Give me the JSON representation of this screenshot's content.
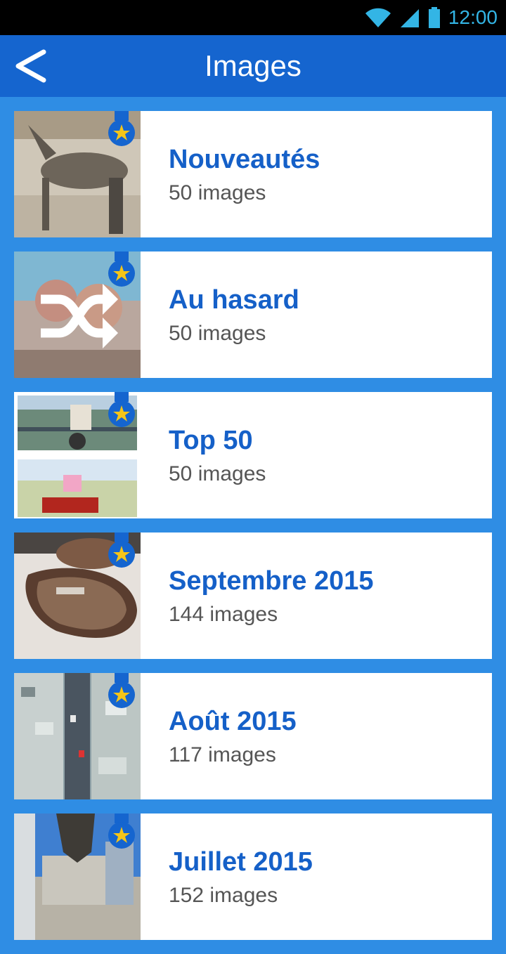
{
  "status_bar": {
    "time": "12:00"
  },
  "header": {
    "title": "Images",
    "back_icon": "chevron-left-icon"
  },
  "colors": {
    "appbar": "#1565cf",
    "background": "#2f8de4",
    "title_text": "#1560c8",
    "badge_star": "#f5c518"
  },
  "albums": [
    {
      "title": "Nouveautés",
      "count": "50 images"
    },
    {
      "title": "Au hasard",
      "count": "50 images"
    },
    {
      "title": "Top 50",
      "count": "50 images"
    },
    {
      "title": "Septembre 2015",
      "count": "144 images"
    },
    {
      "title": "Août 2015",
      "count": "117 images"
    },
    {
      "title": "Juillet 2015",
      "count": "152 images"
    }
  ]
}
